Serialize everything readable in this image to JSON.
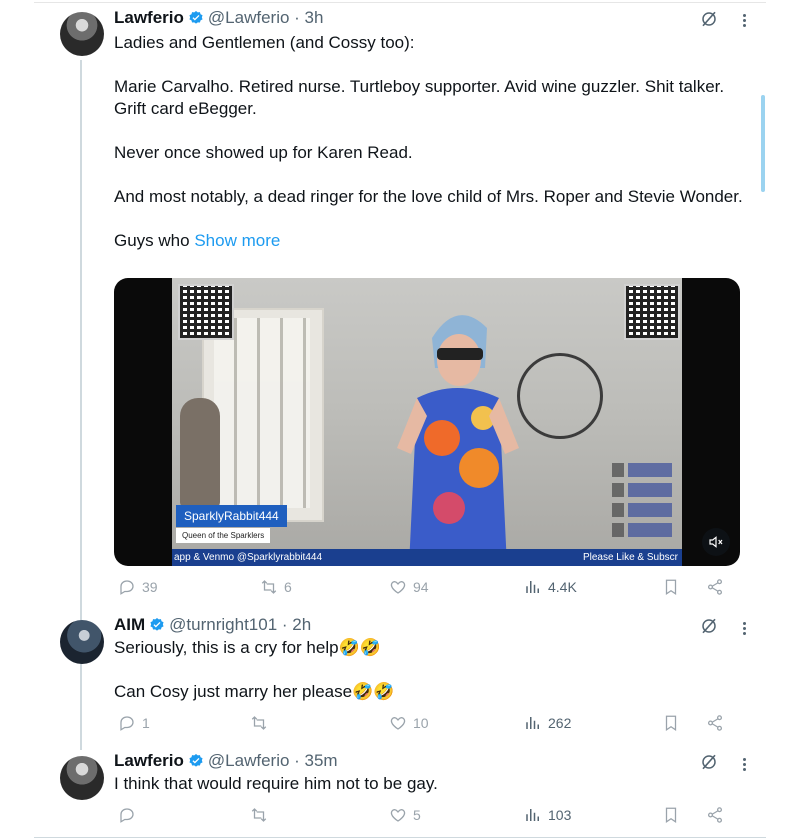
{
  "tweets": [
    {
      "name": "Lawferio",
      "handle_time": "@Lawferio · 3h",
      "text_lines": [
        "Ladies and Gentlemen (and Cossy too):",
        "Marie Carvalho. Retired nurse. Turtleboy supporter. Avid wine guzzler. Shit talker. Grift card eBegger.",
        "Never once showed up for Karen Read.",
        "And most notably, a dead ringer for the love child of Mrs. Roper and Stevie Wonder.",
        "Guys who"
      ],
      "show_more": "Show more",
      "stats": {
        "replies": "39",
        "reposts": "6",
        "likes": "94",
        "views": "4.4K"
      }
    },
    {
      "name": "AIM",
      "handle_time": "@turnright101 · 2h",
      "text_lines": [
        "Seriously, this is a cry for help🤣🤣",
        "Can Cosy just marry her please🤣🤣"
      ],
      "stats": {
        "replies": "1",
        "reposts": "",
        "likes": "10",
        "views": "262"
      }
    },
    {
      "name": "Lawferio",
      "handle_time": "@Lawferio · 35m",
      "text_lines": [
        "I think that would require him not to be gay."
      ],
      "stats": {
        "replies": "",
        "reposts": "",
        "likes": "5",
        "views": "103"
      }
    }
  ],
  "media": {
    "banner_name": "SparklyRabbit444",
    "banner_sub": "Queen of the Sparklers",
    "ticker_left": "app & Venmo @Sparklyrabbit444",
    "ticker_right": "Please Like & Subscr"
  },
  "colors": {
    "verified": "#1d9bf0",
    "link": "#1d9bf0",
    "muted": "#536471"
  },
  "icons": [
    "verified-badge-icon",
    "grok-icon",
    "more-icon",
    "reply-icon",
    "repost-icon",
    "like-icon",
    "views-icon",
    "bookmark-icon",
    "share-icon",
    "mute-icon"
  ]
}
